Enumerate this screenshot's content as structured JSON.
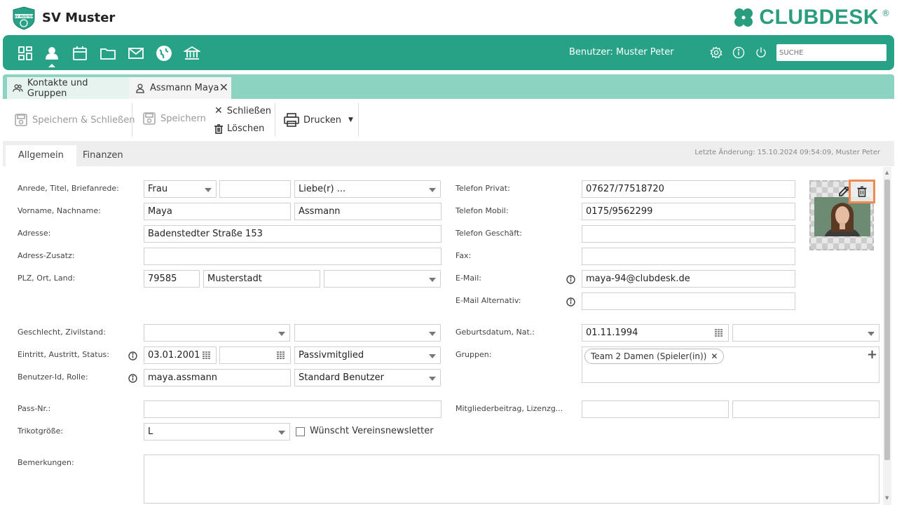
{
  "header": {
    "club_name": "SV Muster",
    "logo_badge_text": "SV MUSTER",
    "brand": "CLUBDESK",
    "brand_registered": "®"
  },
  "navbar": {
    "user_label": "Benutzer: Muster Peter",
    "search_placeholder": "SUCHE",
    "icons": [
      "dashboard-icon",
      "contacts-icon",
      "calendar-icon",
      "folder-icon",
      "mail-icon",
      "globe-icon",
      "bank-icon",
      "gear-icon",
      "info-icon",
      "power-icon"
    ]
  },
  "doc_tabs": [
    {
      "label": "Kontakte und Gruppen"
    },
    {
      "label": "Assmann Maya"
    }
  ],
  "actions": {
    "save_close": "Speichern & Schließen",
    "save": "Speichern",
    "close": "Schließen",
    "delete": "Löschen",
    "print": "Drucken"
  },
  "section_tabs": [
    "Allgemein",
    "Finanzen"
  ],
  "last_change": "Letzte Änderung: 15.10.2024 09:54:09, Muster Peter",
  "form": {
    "labels": {
      "salutation": "Anrede, Titel, Briefanrede:",
      "name": "Vorname, Nachname:",
      "address": "Adresse:",
      "address_extra": "Adress-Zusatz:",
      "zip_city": "PLZ, Ort, Land:",
      "gender": "Geschlecht, Zivilstand:",
      "membership": "Eintritt, Austritt, Status:",
      "user_role": "Benutzer-Id, Rolle:",
      "pass": "Pass-Nr.:",
      "jersey": "Trikotgröße:",
      "remarks": "Bemerkungen:",
      "phone_private": "Telefon Privat:",
      "phone_mobile": "Telefon Mobil:",
      "phone_business": "Telefon Geschäft:",
      "fax": "Fax:",
      "email": "E-Mail:",
      "email_alt": "E-Mail Alternativ:",
      "birth": "Geburtsdatum, Nat.:",
      "groups": "Gruppen:",
      "fee": "Mitgliederbeitrag, Lizenzg..."
    },
    "values": {
      "salutation": "Frau",
      "title": "",
      "letter_salutation": "Liebe(r) ...",
      "first_name": "Maya",
      "last_name": "Assmann",
      "address": "Badenstedter Straße 153",
      "address_extra": "",
      "zip": "79585",
      "city": "Musterstadt",
      "country": "",
      "gender": "",
      "civil_status": "",
      "entry": "03.01.2001",
      "exit": "",
      "status": "Passivmitglied",
      "user_id": "maya.assmann",
      "role": "Standard Benutzer",
      "pass": "",
      "jersey": "L",
      "newsletter_label": "Wünscht Vereinsnewsletter",
      "newsletter_checked": false,
      "phone_private": "07627/77518720",
      "phone_mobile": "0175/9562299",
      "phone_business": "",
      "fax": "",
      "email": "maya-94@clubdesk.de",
      "email_alt": "",
      "birth": "01.11.1994",
      "nationality": "",
      "group_chip": "Team 2 Damen (Spieler(in))",
      "fee": "",
      "license": "",
      "remarks": ""
    }
  },
  "colors": {
    "primary": "#27a287",
    "tab_row": "#8dd3c2",
    "highlight": "#f08a50"
  }
}
